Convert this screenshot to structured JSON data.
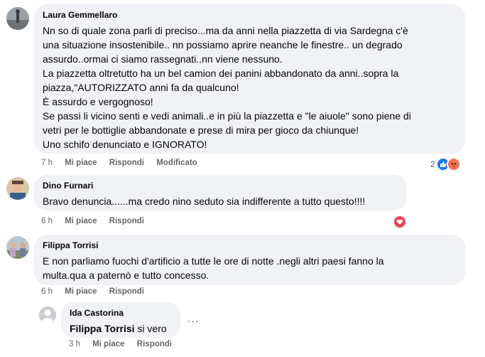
{
  "comments": [
    {
      "author": "Laura Gemmellaro",
      "lines": [
        "Nn so di quale zona parli di preciso...ma da anni nella piazzetta di via Sardegna c'è",
        "una situazione insostenibile.. nn possiamo aprire neanche le finestre.. un degrado",
        "assurdo..ormai ci siamo rassegnati..nn viene nessuno.",
        "La piazzetta oltretutto ha un bel camion dei panini abbandonato da anni..sopra la",
        "piazza,\"AUTORIZZATO anni fa da qualcuno!",
        "È assurdo e vergognoso!",
        "Se passi li vicino senti e vedi animali..e in più la piazzetta e \"le aiuole\" sono piene di",
        "vetri per le bottiglie abbandonate e prese di mira per gioco da chiunque!",
        "Uno schifo denunciato e IGNORATO!"
      ],
      "time": "7 h",
      "like": "Mi piace",
      "reply": "Rispondi",
      "edited": "Modificato",
      "reaction_count": "2"
    },
    {
      "author": "Dino Furnari",
      "lines": [
        "Bravo denuncia......ma credo nino seduto sia indifferente a tutto questo!!!!"
      ],
      "time": "6 h",
      "like": "Mi piace",
      "reply": "Rispondi"
    },
    {
      "author": "Filippa Torrisi",
      "lines": [
        "E non parliamo fuochi d'artificio a tutte le ore di notte .negli altri paesi fanno la",
        "multa.qua a paternò e tutto concesso."
      ],
      "time": "6 h",
      "like": "Mi piace",
      "reply": "Rispondi"
    }
  ],
  "reply": {
    "author": "Ida Castorina",
    "mention": "Filippa Torrisi",
    "text": " si vero",
    "time": "3 h",
    "like": "Mi piace",
    "reply": "Rispondi",
    "more": "..."
  },
  "colors": {
    "bubble": "#f0f2f5",
    "like_blue": "#1877f2",
    "angry_orange": "#f7714c",
    "love_red": "#f33e58",
    "meta_gray": "#65676b"
  },
  "icons": [
    "like-reaction-icon",
    "angry-reaction-icon",
    "love-reaction-icon"
  ]
}
